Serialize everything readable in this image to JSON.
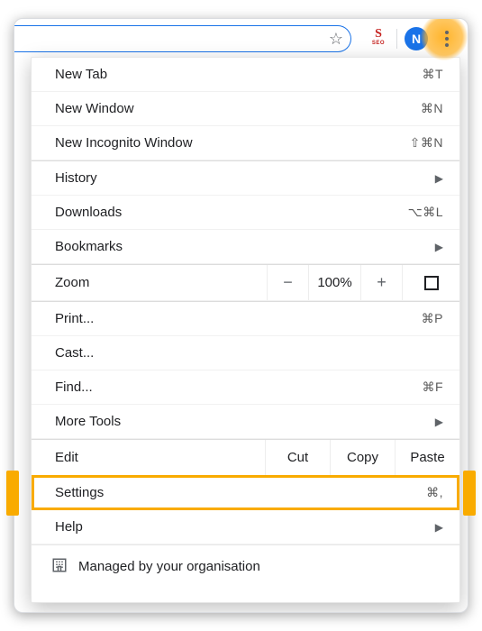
{
  "toolbar": {
    "avatar_initial": "N",
    "extension_letter": "S",
    "extension_sub": "SEO"
  },
  "menu": {
    "new_tab": {
      "label": "New Tab",
      "shortcut": "⌘T"
    },
    "new_window": {
      "label": "New Window",
      "shortcut": "⌘N"
    },
    "new_incognito": {
      "label": "New Incognito Window",
      "shortcut": "⇧⌘N"
    },
    "history": {
      "label": "History"
    },
    "downloads": {
      "label": "Downloads",
      "shortcut": "⌥⌘L"
    },
    "bookmarks": {
      "label": "Bookmarks"
    },
    "zoom": {
      "label": "Zoom",
      "minus": "−",
      "pct": "100%",
      "plus": "+"
    },
    "print": {
      "label": "Print...",
      "shortcut": "⌘P"
    },
    "cast": {
      "label": "Cast..."
    },
    "find": {
      "label": "Find...",
      "shortcut": "⌘F"
    },
    "more_tools": {
      "label": "More Tools"
    },
    "edit": {
      "label": "Edit",
      "cut": "Cut",
      "copy": "Copy",
      "paste": "Paste"
    },
    "settings": {
      "label": "Settings",
      "shortcut": "⌘,"
    },
    "help": {
      "label": "Help"
    },
    "managed": {
      "label": "Managed by your organisation"
    }
  }
}
